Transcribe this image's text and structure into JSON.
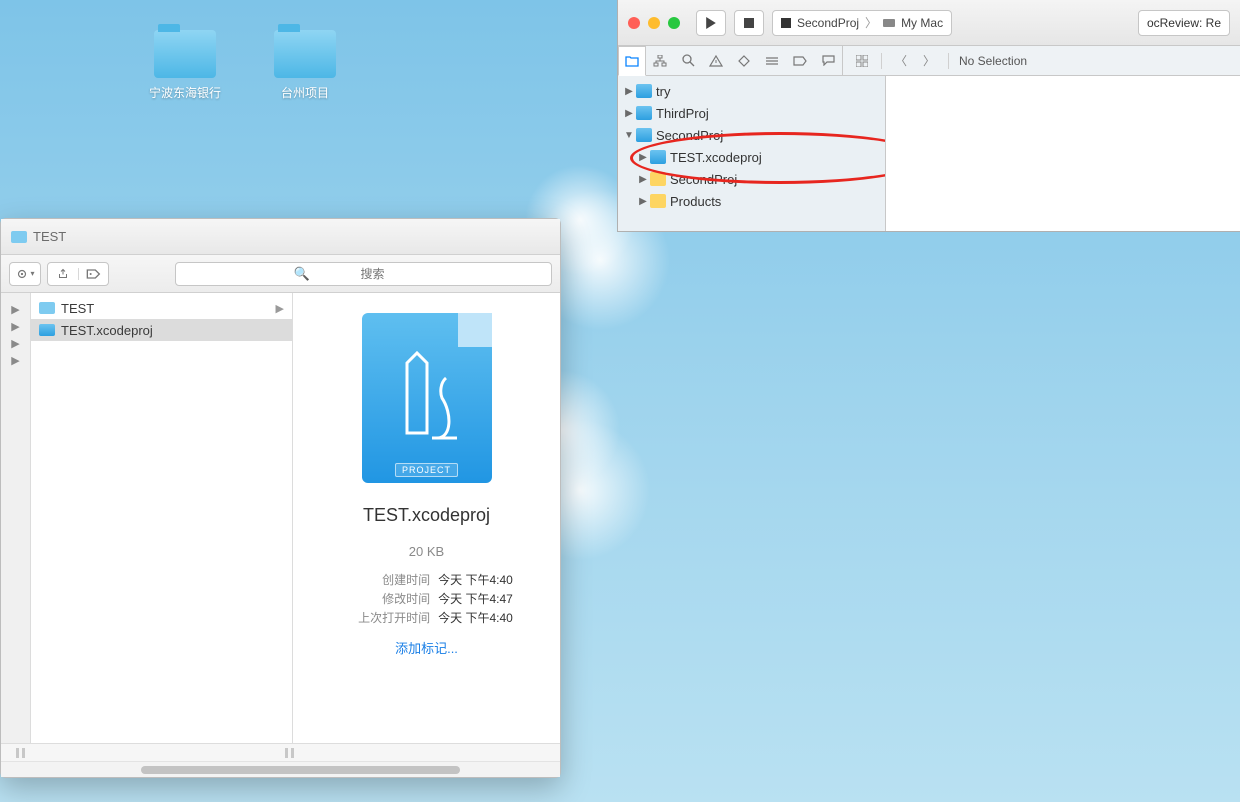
{
  "desktop": {
    "folder1": "宁波东海银行",
    "folder2": "台州项目"
  },
  "finder": {
    "title": "TEST",
    "search_placeholder": "搜索",
    "list": {
      "item0": "TEST",
      "item1": "TEST.xcodeproj"
    },
    "preview": {
      "badge": "PROJECT",
      "name": "TEST.xcodeproj",
      "size": "20 KB",
      "created_label": "创建时间",
      "created_value": "今天 下午4:40",
      "modified_label": "修改时间",
      "modified_value": "今天 下午4:47",
      "opened_label": "上次打开时间",
      "opened_value": "今天 下午4:40",
      "tags": "添加标记..."
    }
  },
  "xcode": {
    "scheme_proj": "SecondProj",
    "scheme_dest": "My Mac",
    "status": "ocReview: Re",
    "jump": {
      "no_selection": "No Selection"
    },
    "tree": {
      "n0": "try",
      "n1": "ThirdProj",
      "n2": "SecondProj",
      "n3": "TEST.xcodeproj",
      "n4": "SecondProj",
      "n5": "Products"
    }
  }
}
